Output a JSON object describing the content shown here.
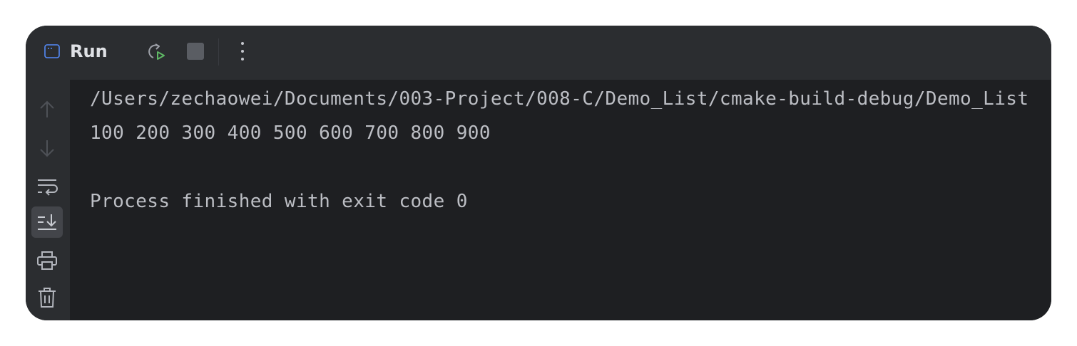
{
  "toolbar": {
    "title": "Run",
    "buttons": {
      "rerun": "rerun-icon",
      "stop": "stop-icon",
      "more": "more-vertical-icon"
    }
  },
  "sidebar": {
    "items": [
      {
        "icon": "arrow-up-icon",
        "active": false
      },
      {
        "icon": "arrow-down-icon",
        "active": false
      },
      {
        "icon": "soft-wrap-icon",
        "active": false
      },
      {
        "icon": "scroll-to-end-icon",
        "active": true
      },
      {
        "icon": "print-icon",
        "active": false
      },
      {
        "icon": "trash-icon",
        "active": false
      }
    ]
  },
  "console": {
    "lines": [
      "/Users/zechaowei/Documents/003-Project/008-C/Demo_List/cmake-build-debug/Demo_List",
      "100 200 300 400 500 600 700 800 900",
      "",
      "Process finished with exit code 0"
    ]
  },
  "colors": {
    "background": "#1e1f22",
    "toolbar": "#2b2d30",
    "text": "#bcbec4",
    "accent_green": "#5fb865",
    "accent_blue": "#548af7"
  }
}
